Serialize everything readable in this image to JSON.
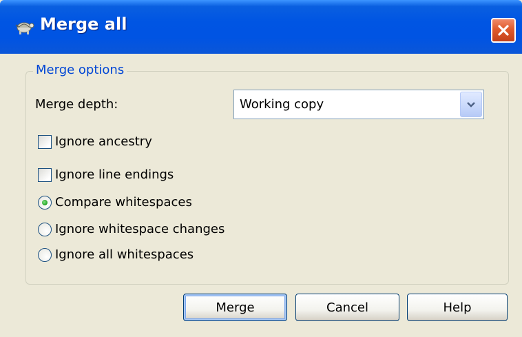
{
  "window": {
    "title": "Merge all",
    "app_icon": "tortoise-icon",
    "close_icon": "close-icon"
  },
  "group": {
    "title": "Merge options"
  },
  "merge_depth": {
    "label": "Merge depth:",
    "selected": "Working copy"
  },
  "checkboxes": [
    {
      "label": "Ignore ancestry",
      "checked": false
    },
    {
      "label": "Ignore line endings",
      "checked": false
    }
  ],
  "radios": [
    {
      "label": "Compare whitespaces",
      "selected": true
    },
    {
      "label": "Ignore whitespace changes",
      "selected": false
    },
    {
      "label": "Ignore all whitespaces",
      "selected": false
    }
  ],
  "buttons": {
    "merge": "Merge",
    "cancel": "Cancel",
    "help": "Help"
  },
  "colors": {
    "titlebar": "#0054e3",
    "dialog_bg": "#ece9d8",
    "group_title": "#0046d5",
    "radio_selected": "#21a121",
    "close_button": "#e05a2c"
  }
}
